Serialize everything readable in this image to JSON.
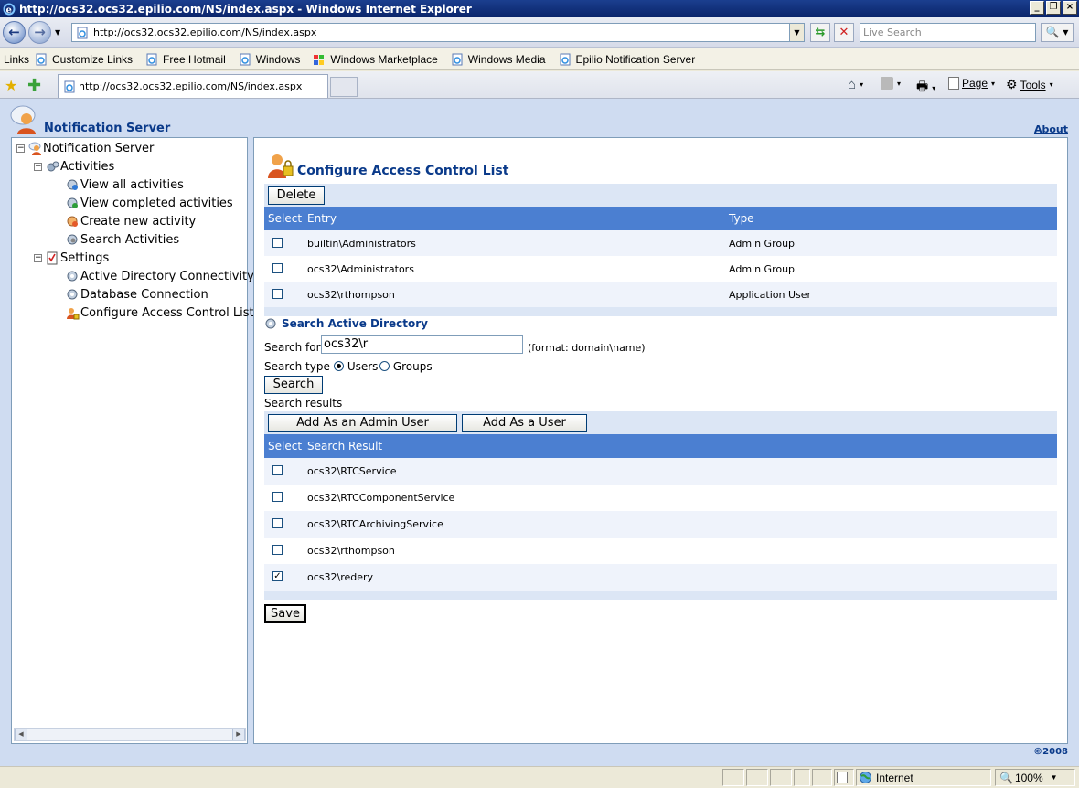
{
  "window": {
    "title": "http://ocs32.ocs32.epilio.com/NS/index.aspx - Windows Internet Explorer"
  },
  "address": {
    "url": "http://ocs32.ocs32.epilio.com/NS/index.aspx",
    "search_placeholder": "Live Search"
  },
  "links_bar": {
    "label": "Links",
    "items": [
      "Customize Links",
      "Free Hotmail",
      "Windows",
      "Windows Marketplace",
      "Windows Media",
      "Epilio Notification Server"
    ]
  },
  "tab": {
    "title": "http://ocs32.ocs32.epilio.com/NS/index.aspx"
  },
  "commands": {
    "page": "Page",
    "tools": "Tools"
  },
  "app": {
    "title": "Notification Server",
    "about": "About",
    "copyright": "©2008"
  },
  "tree": {
    "root": "Notification Server",
    "activities": "Activities",
    "view_all": "View all activities",
    "view_completed": "View completed activities",
    "create_new": "Create new activity",
    "search_activities": "Search Activities",
    "settings": "Settings",
    "ad_connectivity": "Active Directory Connectivity",
    "db_connection": "Database Connection",
    "configure_acl": "Configure Access Control List"
  },
  "main": {
    "heading": "Configure Access Control List",
    "delete_label": "Delete",
    "acl_columns": [
      "Select",
      "Entry",
      "Type"
    ],
    "acl_rows": [
      {
        "entry": "builtin\\Administrators",
        "type": "Admin Group",
        "checked": false
      },
      {
        "entry": "ocs32\\Administrators",
        "type": "Admin Group",
        "checked": false
      },
      {
        "entry": "ocs32\\rthompson",
        "type": "Application User",
        "checked": false
      }
    ],
    "search_heading": "Search Active Directory",
    "search_for_label": "Search for",
    "search_value": "ocs32\\r",
    "format_hint": "(format: domain\\name)",
    "search_type_label": "Search type",
    "search_type_users": "Users",
    "search_type_groups": "Groups",
    "search_type_selected": "Users",
    "search_button": "Search",
    "results_label": "Search results",
    "add_admin_label": "Add As an Admin User",
    "add_user_label": "Add As a User",
    "result_columns": [
      "Select",
      "Search Result"
    ],
    "result_rows": [
      {
        "name": "ocs32\\RTCService",
        "checked": false
      },
      {
        "name": "ocs32\\RTCComponentService",
        "checked": false
      },
      {
        "name": "ocs32\\RTCArchivingService",
        "checked": false
      },
      {
        "name": "ocs32\\rthompson",
        "checked": false
      },
      {
        "name": "ocs32\\redery",
        "checked": true
      }
    ],
    "save_label": "Save"
  },
  "status": {
    "zone": "Internet",
    "zoom": "100%"
  },
  "colors": {
    "grid_header": "#4b7fd1",
    "brand_text": "#0a3a8a",
    "page_bg": "#cfdcf1"
  }
}
